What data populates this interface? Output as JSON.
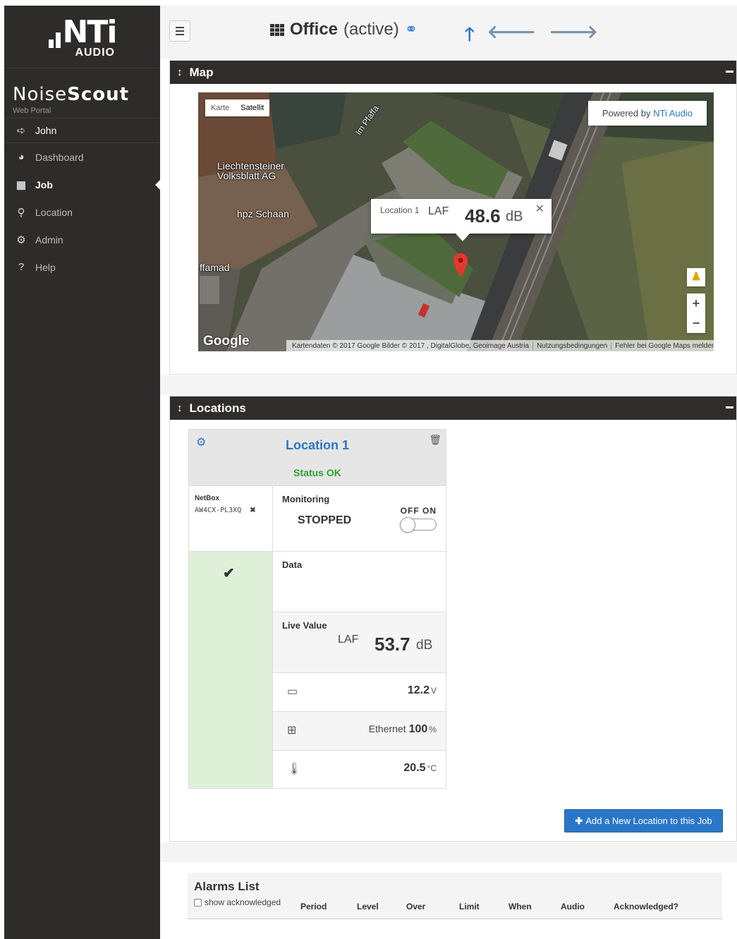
{
  "sidebar": {
    "logo_text": "NTi",
    "logo_sub": "AUDIO",
    "brand_light": "Noise",
    "brand_bold": "Scout",
    "brand_sub": "Web Portal",
    "user": "John",
    "items": [
      {
        "label": "Dashboard",
        "icon": "dashboard-icon"
      },
      {
        "label": "Job",
        "icon": "grid-icon",
        "active": true
      },
      {
        "label": "Location",
        "icon": "map-marker-icon"
      },
      {
        "label": "Admin",
        "icon": "cogs-icon"
      },
      {
        "label": "Help",
        "icon": "question-circle-icon"
      }
    ]
  },
  "header": {
    "job_name": "Office",
    "job_status": "(active)"
  },
  "map_panel": {
    "title": "Map",
    "map_type": [
      "Karte",
      "Satellit"
    ],
    "map_type_selected": "Satellit",
    "powered_prefix": "Powered by",
    "powered_link": "NTi Audio",
    "info_window": {
      "location": "Location 1",
      "metric": "LAF",
      "value": "48.6",
      "unit": "dB"
    },
    "labels": {
      "street": "Im Pfaffa",
      "poi1_line1": "Liechtensteiner",
      "poi1_line2": "Volksblatt AG",
      "poi2": "hpz Schaan",
      "poi3": "ffamad"
    },
    "google": "Google",
    "footer": [
      "Kartendaten © 2017 Google Bilder © 2017 , DigitalGlobe, Geoimage Austria",
      "Nutzungsbedingungen",
      "Fehler bei Google Maps melden"
    ]
  },
  "locations_panel": {
    "title": "Locations",
    "card": {
      "name": "Location 1",
      "status": "Status OK",
      "netbox_label": "NetBox",
      "netbox_id": "AW4CX-PL3XQ",
      "monitoring_label": "Monitoring",
      "monitoring_state": "STOPPED",
      "toggle_off": "OFF",
      "toggle_on": "ON",
      "toggle_state": "off",
      "data_label": "Data",
      "live_label": "Live Value",
      "live_metric": "LAF",
      "live_value": "53.7",
      "live_unit": "dB",
      "battery_value": "12.2",
      "battery_unit": "V",
      "network_type": "Ethernet",
      "network_value": "100",
      "network_unit": "%",
      "temperature_value": "20.5",
      "temperature_unit": "°C"
    },
    "add_button": "Add a New Location to this Job"
  },
  "alarms": {
    "title": "Alarms List",
    "show_acknowledged": "show acknowledged",
    "columns": [
      "Period",
      "Level",
      "Over",
      "Limit",
      "When",
      "Audio",
      "Acknowledged?"
    ]
  },
  "colors": {
    "accent": "#2a77c9",
    "sidebar_bg": "#2e2c2a",
    "panel_head": "#2f2d2b",
    "status_ok": "#2ea12e",
    "ok_bg": "#dff0d8"
  }
}
